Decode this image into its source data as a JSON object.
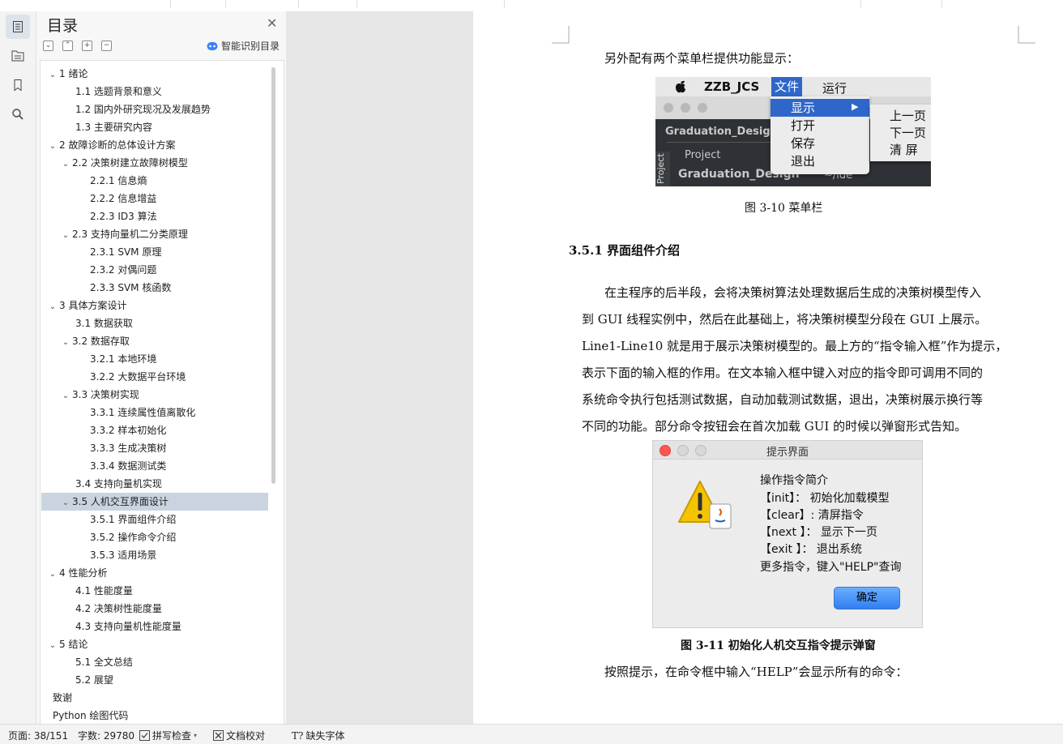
{
  "panel": {
    "title": "目录",
    "smart_label": "智能识别目录"
  },
  "toc": [
    {
      "level": 1,
      "arrow": "expanded",
      "label": "1  绪论"
    },
    {
      "level": 2,
      "arrow": "none",
      "label": "1.1  选题背景和意义"
    },
    {
      "level": 2,
      "arrow": "none",
      "label": "1.2  国内外研究现况及发展趋势"
    },
    {
      "level": 2,
      "arrow": "none",
      "label": "1.3  主要研究内容"
    },
    {
      "level": 1,
      "arrow": "expanded",
      "label": "2  故障诊断的总体设计方案"
    },
    {
      "level": 2,
      "arrow": "expanded",
      "label": "2.2  决策树建立故障树模型"
    },
    {
      "level": 3,
      "arrow": "none",
      "label": "2.2.1  信息熵"
    },
    {
      "level": 3,
      "arrow": "none",
      "label": "2.2.2  信息增益"
    },
    {
      "level": 3,
      "arrow": "none",
      "label": "2.2.3 ID3 算法"
    },
    {
      "level": 2,
      "arrow": "expanded",
      "label": "2.3  支持向量机二分类原理"
    },
    {
      "level": 3,
      "arrow": "none",
      "label": "2.3.1 SVM 原理"
    },
    {
      "level": 3,
      "arrow": "none",
      "label": "2.3.2  对偶问题"
    },
    {
      "level": 3,
      "arrow": "none",
      "label": "2.3.3 SVM 核函数"
    },
    {
      "level": 1,
      "arrow": "expanded",
      "label": "3  具体方案设计"
    },
    {
      "level": 2,
      "arrow": "none",
      "label": "3.1  数据获取"
    },
    {
      "level": 2,
      "arrow": "expanded",
      "label": "3.2  数据存取"
    },
    {
      "level": 3,
      "arrow": "none",
      "label": "3.2.1  本地环境"
    },
    {
      "level": 3,
      "arrow": "none",
      "label": "3.2.2  大数据平台环境"
    },
    {
      "level": 2,
      "arrow": "expanded",
      "label": "3.3  决策树实现"
    },
    {
      "level": 3,
      "arrow": "none",
      "label": "3.3.1  连续属性值离散化"
    },
    {
      "level": 3,
      "arrow": "none",
      "label": "3.3.2  样本初始化"
    },
    {
      "level": 3,
      "arrow": "none",
      "label": "3.3.3  生成决策树"
    },
    {
      "level": 3,
      "arrow": "none",
      "label": "3.3.4  数据测试类"
    },
    {
      "level": 2,
      "arrow": "none",
      "label": "3.4  支持向量机实现"
    },
    {
      "level": 2,
      "arrow": "expanded",
      "label": "3.5  人机交互界面设计",
      "selected": true
    },
    {
      "level": 3,
      "arrow": "none",
      "label": "3.5.1  界面组件介绍"
    },
    {
      "level": 3,
      "arrow": "none",
      "label": "3.5.2  操作命令介绍"
    },
    {
      "level": 3,
      "arrow": "none",
      "label": "3.5.3  适用场景"
    },
    {
      "level": 1,
      "arrow": "expanded",
      "label": "4  性能分析"
    },
    {
      "level": 2,
      "arrow": "none",
      "label": "4.1  性能度量"
    },
    {
      "level": 2,
      "arrow": "none",
      "label": "4.2  决策树性能度量"
    },
    {
      "level": 2,
      "arrow": "none",
      "label": "4.3  支持向量机性能度量"
    },
    {
      "level": 1,
      "arrow": "expanded",
      "label": "5  结论"
    },
    {
      "level": 2,
      "arrow": "none",
      "label": "5.1  全文总结"
    },
    {
      "level": 2,
      "arrow": "none",
      "label": "5.2  展望"
    },
    {
      "level": 1,
      "arrow": "none",
      "label": "致谢"
    },
    {
      "level": 1,
      "arrow": "none",
      "label": "Python 绘图代码"
    }
  ],
  "doc": {
    "intro_line": "另外配有两个菜单栏提供功能显示：",
    "fig1_caption": "图 3-10  菜单栏",
    "section_heading": "3.5.1  界面组件介绍",
    "para_lines": [
      "在主程序的后半段，会将决策树算法处理数据后生成的决策树模型传入",
      "到 GUI 线程实例中，然后在此基础上，将决策树模型分段在 GUI 上展示。",
      "Line1-Line10 就是用于展示决策树模型的。最上方的“指令输入框”作为提示，",
      "表示下面的输入框的作用。在文本输入框中键入对应的指令即可调用不同的",
      "系统命令执行包括测试数据，自动加载测试数据，退出，决策树展示换行等",
      "不同的功能。部分命令按钮会在首次加载 GUI 的时候以弹窗形式告知。"
    ],
    "fig2_caption": "图 3-11  初始化人机交互指令提示弹窗",
    "last_line": "按照提示，在命令框中输入“HELP”会显示所有的命令："
  },
  "fig1": {
    "app_name": "ZZB_JCS",
    "menu_file": "文件",
    "menu_run": "运行",
    "dd_show": "显示",
    "dd_open": "打开",
    "dd_save": "保存",
    "dd_exit": "退出",
    "sub_prev": "上一页",
    "sub_next": "下一页",
    "sub_clear": "清 屏",
    "project_title": "Graduation_Desig",
    "project_label": "Project",
    "tree_item": "Graduation_Design",
    "tree_path": "~/ide",
    "side_tab": "Project"
  },
  "fig2": {
    "title": "提示界面",
    "lines": [
      "操作指令简介",
      "【init】： 初始化加载模型",
      "【clear】: 清屏指令",
      "【next 】： 显示下一页",
      "【exit 】：  退出系统",
      "更多指令，键入\"HELP\"查询"
    ],
    "ok": "确定"
  },
  "status": {
    "page": "页面: 38/151",
    "words": "字数: 29780",
    "spell": "拼写检查",
    "proof": "文档校对",
    "missing_font": "缺失字体"
  },
  "colors": {
    "menu_highlight": "#2f66c9",
    "toc_selected": "#c9d4e0"
  }
}
